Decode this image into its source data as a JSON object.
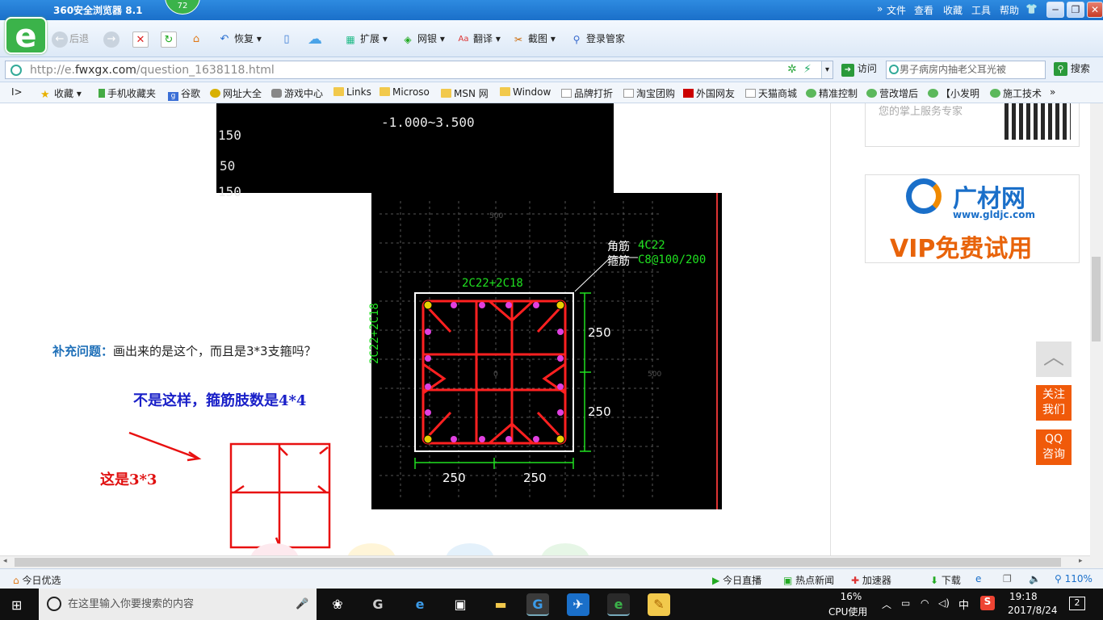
{
  "window": {
    "title": "360安全浏览器 8.1",
    "badge": "72",
    "menu": [
      "文件",
      "查看",
      "收藏",
      "工具",
      "帮助"
    ],
    "controls": [
      "─",
      "❐",
      "✕"
    ]
  },
  "toolbar": {
    "back": "后退",
    "restore": "恢复",
    "items": [
      "扩展",
      "网银",
      "翻译",
      "截图",
      "登录管家"
    ]
  },
  "address": {
    "url_prefix": "http://e.",
    "url_domain": "fwxgx.com",
    "url_path": "/question_1638118.html",
    "go_label": "访问",
    "search_value": "男子病房内抽老父耳光被",
    "search_button": "搜索"
  },
  "favorites": [
    "收藏",
    "手机收藏夹",
    "谷歌",
    "网址大全",
    "游戏中心",
    "Links",
    "Microso",
    "MSN 网",
    "Window",
    "品牌打折",
    "淘宝团购",
    "外国网友",
    "天猫商城",
    "精准控制",
    "营改增后",
    "【小发明",
    "施工技术"
  ],
  "article": {
    "supp_label": "补充问题：",
    "supp_text": "画出来的是这个，而且是3*3支箍吗？",
    "answer": "不是这样，箍筋肢数是4*4",
    "note": "这是3*3"
  },
  "cad_top": {
    "range": "-1.000~3.500",
    "labels": [
      "150",
      "50",
      "150"
    ]
  },
  "cad": {
    "corner_label": "角筋",
    "corner_value": "4C22",
    "stirrup_label": "箍筋",
    "stirrup_value": "C8@100/200",
    "top_bar": "2C22+2C18",
    "side_bar": "2C22+2C18",
    "dim_right_1": "250",
    "dim_right_2": "250",
    "dim_bottom_1": "250",
    "dim_bottom_2": "250",
    "grid_top": "500",
    "grid_right": "500",
    "center": "0"
  },
  "ads": {
    "qr_text": "您的掌上服务专家",
    "brand": "广材网",
    "brand_url": "www.gldjc.com",
    "promo": "VIP免费试用"
  },
  "side_buttons": {
    "follow": "关注我们",
    "qq": "QQ咨询"
  },
  "status": {
    "left": "今日优选",
    "items": [
      "今日直播",
      "热点新闻",
      "加速器",
      "下载"
    ],
    "zoom": "110%"
  },
  "taskbar": {
    "search_placeholder": "在这里输入你要搜索的内容",
    "cpu_percent": "16%",
    "cpu_label": "CPU使用",
    "ime": "中",
    "time": "19:18",
    "date": "2017/8/24",
    "notifications": "2"
  }
}
